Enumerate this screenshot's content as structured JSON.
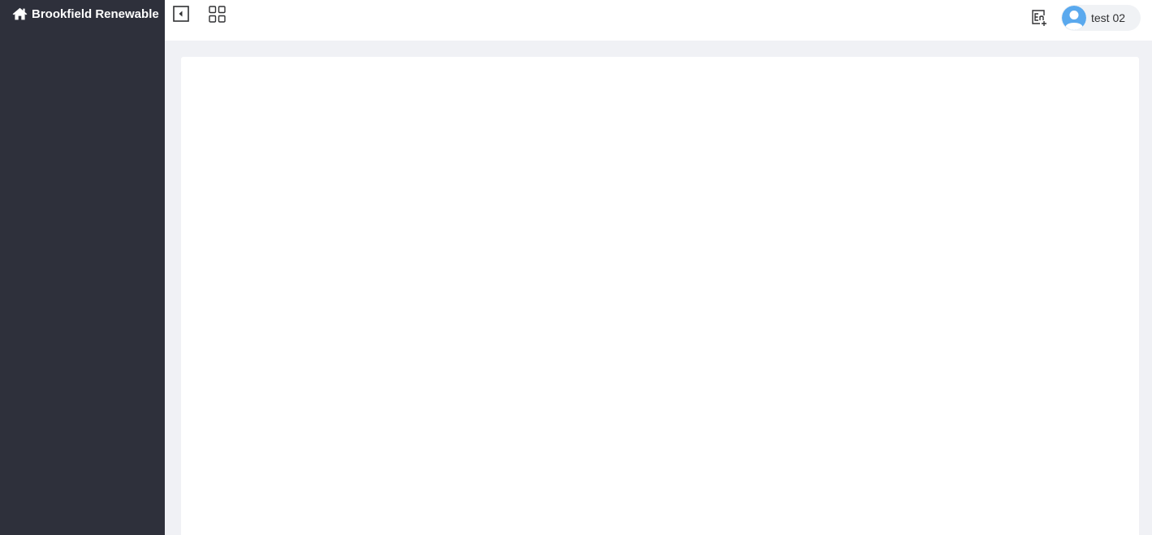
{
  "sidebar": {
    "brand": {
      "icon": "home-icon",
      "label": "Brookfield Renewable"
    },
    "background_color": "#2e303b"
  },
  "header": {
    "collapse_icon": "collapse-sidebar-icon",
    "apps_icon": "grid-apps-icon",
    "language_icon": "language-switch-icon",
    "user": {
      "avatar_icon": "user-avatar-icon",
      "name": "test 02"
    }
  },
  "colors": {
    "sidebar": "#2e303b",
    "main_background": "#f0f1f5",
    "avatar": "#5aa9ee"
  }
}
